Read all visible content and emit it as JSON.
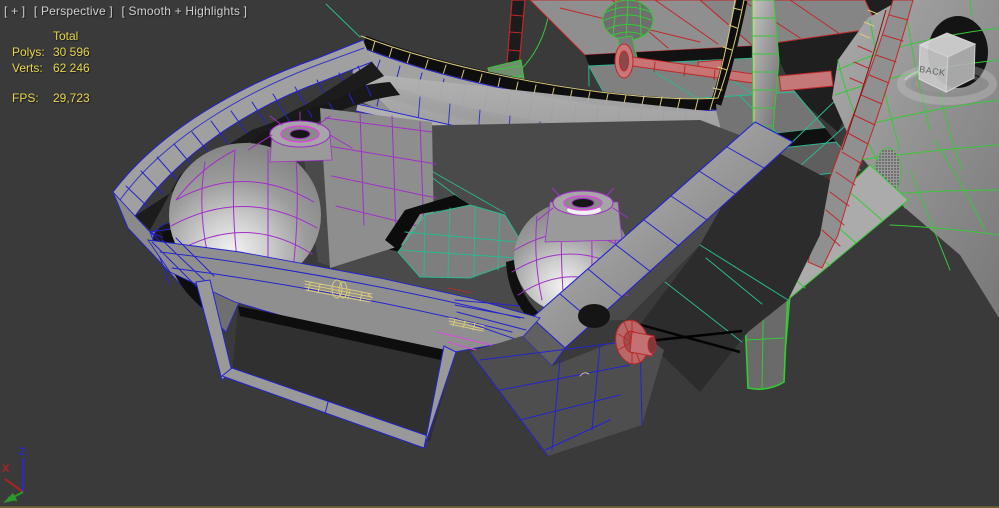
{
  "colors": {
    "bg": "#3a3a3a",
    "label_text": "#cfcfcf",
    "stats_text": "#e6d34a",
    "wire_blue": "#2323cf",
    "wire_purple": "#a030c8",
    "wire_magenta": "#dd4ae0",
    "wire_teal": "#2ab890",
    "wire_green": "#38c838",
    "wire_red": "#c02828",
    "wire_salmon": "#c87474",
    "wire_yellow": "#d9c97c",
    "axis_x": "#b22222",
    "axis_y": "#2a9a2a",
    "axis_z": "#2a2ac8",
    "bottom_border": "#6b5d33",
    "viewcube_face": "#c9c9c9"
  },
  "viewport": {
    "menus": {
      "general": "[ + ]",
      "point_of_view": "[ Perspective ]",
      "shading": "[ Smooth + Highlights ]"
    },
    "stats": {
      "column_header": "Total",
      "rows": [
        {
          "label": "Polys:",
          "value": "30 596"
        },
        {
          "label": "Verts:",
          "value": "62 246"
        }
      ],
      "fps_label": "FPS:",
      "fps_value": "29,723"
    },
    "viewcube": {
      "visible_face": "BACK"
    },
    "axis_gizmo": {
      "x_label": "X",
      "z_label": "Z"
    }
  }
}
